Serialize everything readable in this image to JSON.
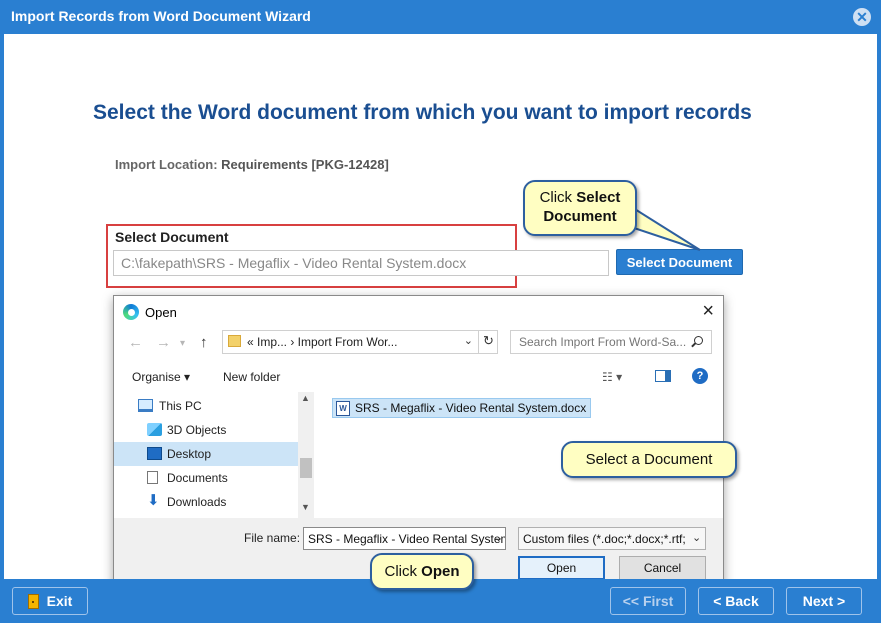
{
  "window": {
    "title": "Import Records from Word Document Wizard",
    "close_glyph": "✕"
  },
  "wizard": {
    "heading": "Select the Word document from which you want to import records",
    "import_location_label": "Import Location:",
    "import_location_value": "Requirements [PKG-12428]",
    "select_document_label": "Select Document",
    "document_path": "C:\\fakepath\\SRS - Megaflix - Video Rental System.docx",
    "select_document_button": "Select Document"
  },
  "callouts": {
    "select_document_prefix": "Click",
    "select_document_bold": "Select Document",
    "select_a_document": "Select a Document",
    "open_prefix": "Click",
    "open_bold": "Open"
  },
  "footer": {
    "exit": "Exit",
    "first": "<< First",
    "back": "< Back",
    "next": "Next >"
  },
  "open_dialog": {
    "title": "Open",
    "address_path": "«   Imp...   ›   Import From Wor...",
    "search_placeholder": "Search Import From Word-Sa...",
    "organise": "Organise ▾",
    "new_folder": "New folder",
    "view_glyph": "☷ ▾",
    "help_glyph": "?",
    "nav_items": [
      {
        "label": "This PC",
        "icon": "pc-icon"
      },
      {
        "label": "3D Objects",
        "icon": "3d-objects-icon"
      },
      {
        "label": "Desktop",
        "icon": "desktop-icon"
      },
      {
        "label": "Documents",
        "icon": "documents-icon"
      },
      {
        "label": "Downloads",
        "icon": "downloads-icon"
      }
    ],
    "selected_nav": "Desktop",
    "files": [
      {
        "name": "SRS - Megaflix - Video Rental System.docx",
        "icon": "word-document-icon",
        "selected": true
      }
    ],
    "file_name_label": "File name:",
    "file_name_value": "SRS - Megaflix - Video Rental System.docx",
    "file_type_value": "Custom files (*.doc;*.docx;*.rtf;",
    "open_button": "Open",
    "cancel_button": "Cancel"
  },
  "colors": {
    "wizard_blue": "#2a7fd1",
    "heading_blue": "#1a4e91",
    "highlight_red": "#d84040",
    "callout_fill": "#fffec2"
  }
}
